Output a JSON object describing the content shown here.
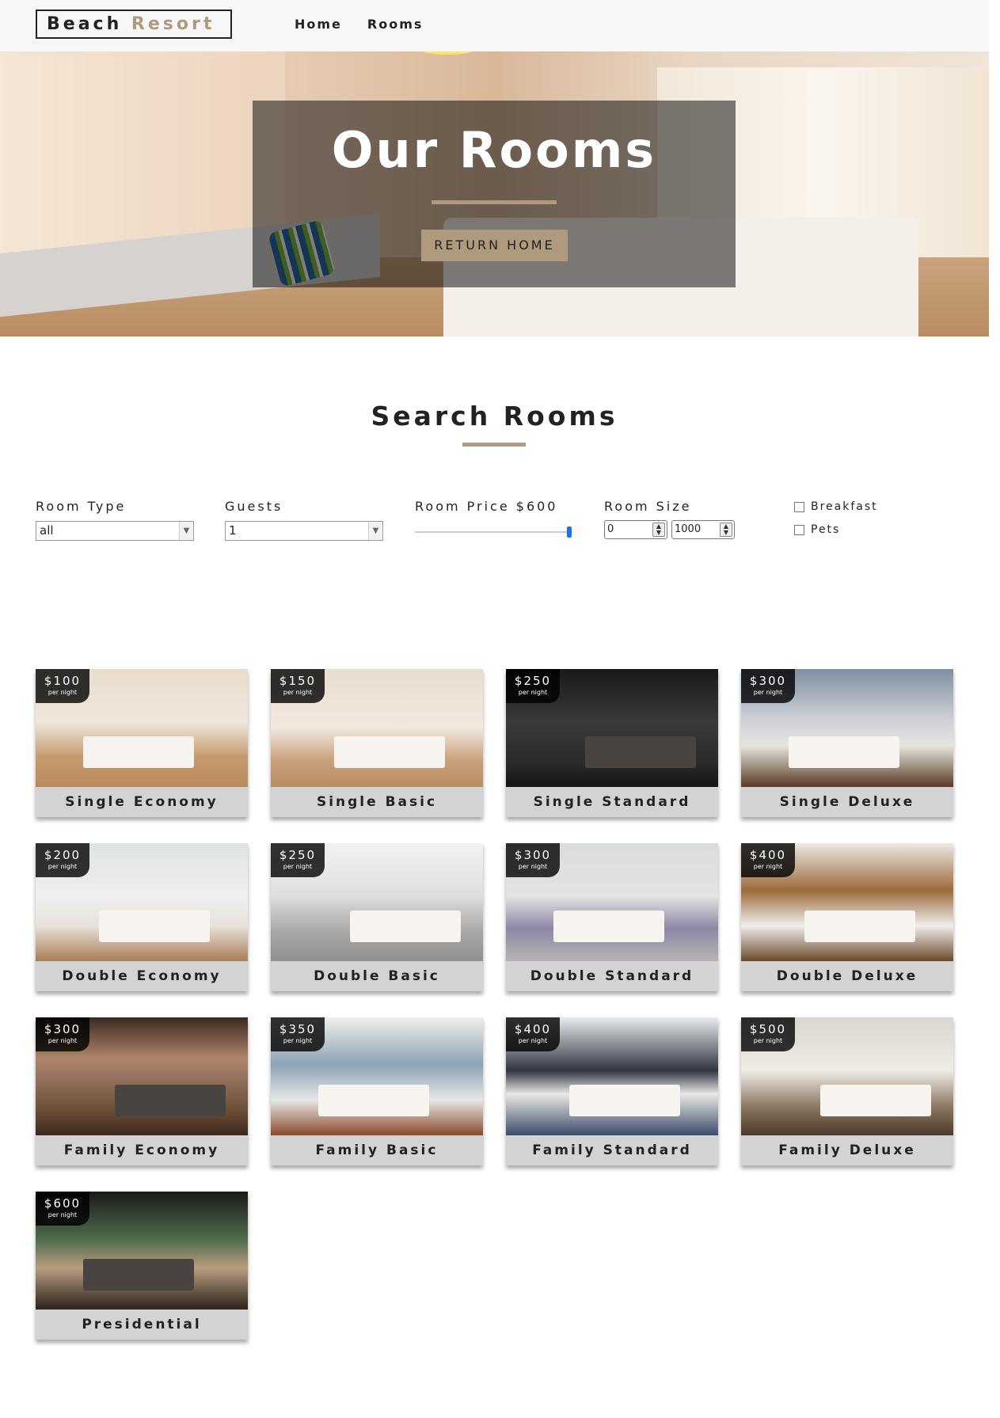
{
  "nav": {
    "logo_part1": "Beach",
    "logo_part2": "Resort",
    "links": [
      "Home",
      "Rooms"
    ]
  },
  "hero": {
    "title": "Our Rooms",
    "button_label": "RETURN HOME"
  },
  "search": {
    "title": "Search Rooms",
    "room_type": {
      "label": "Room Type",
      "value": "all"
    },
    "guests": {
      "label": "Guests",
      "value": "1"
    },
    "price": {
      "label": "Room Price $600",
      "value": 600,
      "min": 0,
      "max": 600
    },
    "size": {
      "label": "Room Size",
      "min_value": "0",
      "max_value": "1000"
    },
    "breakfast": {
      "label": "Breakfast",
      "checked": false
    },
    "pets": {
      "label": "Pets",
      "checked": false
    }
  },
  "per_night_label": "per night",
  "rooms": [
    {
      "name": "Single Economy",
      "price": "$100"
    },
    {
      "name": "Single Basic",
      "price": "$150"
    },
    {
      "name": "Single Standard",
      "price": "$250"
    },
    {
      "name": "Single Deluxe",
      "price": "$300"
    },
    {
      "name": "Double Economy",
      "price": "$200"
    },
    {
      "name": "Double Basic",
      "price": "$250"
    },
    {
      "name": "Double Standard",
      "price": "$300"
    },
    {
      "name": "Double Deluxe",
      "price": "$400"
    },
    {
      "name": "Family Economy",
      "price": "$300"
    },
    {
      "name": "Family Basic",
      "price": "$350"
    },
    {
      "name": "Family Standard",
      "price": "$400"
    },
    {
      "name": "Family Deluxe",
      "price": "$500"
    },
    {
      "name": "Presidential",
      "price": "$600"
    }
  ],
  "colors": {
    "accent": "#af9a7d",
    "text": "#222222",
    "nav_bg": "#f7f7f7",
    "card_footer": "#d3d3d3",
    "slider_thumb": "#1a73e8"
  }
}
